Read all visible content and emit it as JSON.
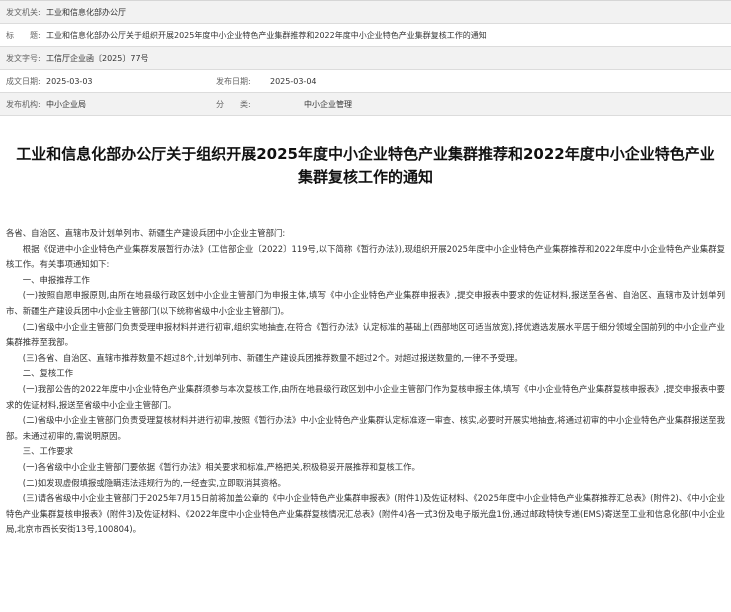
{
  "meta": {
    "issuer_label": "发文机关:",
    "issuer_value": "工业和信息化部办公厅",
    "title_label": "标　　题:",
    "title_value": "工业和信息化部办公厅关于组织开展2025年度中小企业特色产业集群推荐和2022年度中小企业特色产业集群复核工作的通知",
    "docno_label": "发文字号:",
    "docno_value": "工信厅企业函〔2025〕77号",
    "date_label": "成文日期:",
    "date_value": "2025-03-03",
    "publish_label": "发布日期:",
    "publish_value": "2025-03-04",
    "org_label": "发布机构:",
    "org_value": "中小企业局",
    "category_label": "分　　类:",
    "category_value": "中小企业管理"
  },
  "article": {
    "title": "工业和信息化部办公厅关于组织开展2025年度中小企业特色产业集群推荐和2022年度中小企业特色产业集群复核工作的通知",
    "paragraphs": [
      "各省、自治区、直辖市及计划单列市、新疆生产建设兵团中小企业主管部门:",
      "根据《促进中小企业特色产业集群发展暂行办法》(工信部企业〔2022〕119号,以下简称《暂行办法》),现组织开展2025年度中小企业特色产业集群推荐和2022年度中小企业特色产业集群复核工作。有关事项通知如下:",
      "一、申报推荐工作",
      "(一)按照自愿申报原则,由所在地县级行政区划中小企业主管部门为申报主体,填写《中小企业特色产业集群申报表》,提交申报表中要求的佐证材料,报送至各省、自治区、直辖市及计划单列市、新疆生产建设兵团中小企业主管部门(以下统称省级中小企业主管部门)。",
      "(二)省级中小企业主管部门负责受理申报材料并进行初审,组织实地抽查,在符合《暂行办法》认定标准的基础上(西部地区可适当放宽),择优遴选发展水平居于细分领域全国前列的中小企业产业集群推荐至我部。",
      "(三)各省、自治区、直辖市推荐数量不超过8个,计划单列市、新疆生产建设兵团推荐数量不超过2个。对超过报送数量的,一律不予受理。",
      "二、复核工作",
      "(一)我部公告的2022年度中小企业特色产业集群须参与本次复核工作,由所在地县级行政区划中小企业主管部门作为复核申报主体,填写《中小企业特色产业集群复核申报表》,提交申报表中要求的佐证材料,报送至省级中小企业主管部门。",
      "(二)省级中小企业主管部门负责受理复核材料并进行初审,按照《暂行办法》中小企业特色产业集群认定标准逐一审查、核实,必要时开展实地抽查,将通过初审的中小企业特色产业集群报送至我部。未通过初审的,需说明原因。",
      "三、工作要求",
      "(一)各省级中小企业主管部门要依据《暂行办法》相关要求和标准,严格把关,积极稳妥开展推荐和复核工作。",
      "(二)如发现虚假填报或隐瞒违法违规行为的,一经查实,立即取消其资格。",
      "(三)请各省级中小企业主管部门于2025年7月15日前将加盖公章的《中小企业特色产业集群申报表》(附件1)及佐证材料、《2025年度中小企业特色产业集群推荐汇总表》(附件2)、《中小企业特色产业集群复核申报表》(附件3)及佐证材料、《2022年度中小企业特色产业集群复核情况汇总表》(附件4)各一式3份及电子版光盘1份,通过邮政特快专递(EMS)寄送至工业和信息化部(中小企业局,北京市西长安街13号,100804)。"
    ]
  }
}
